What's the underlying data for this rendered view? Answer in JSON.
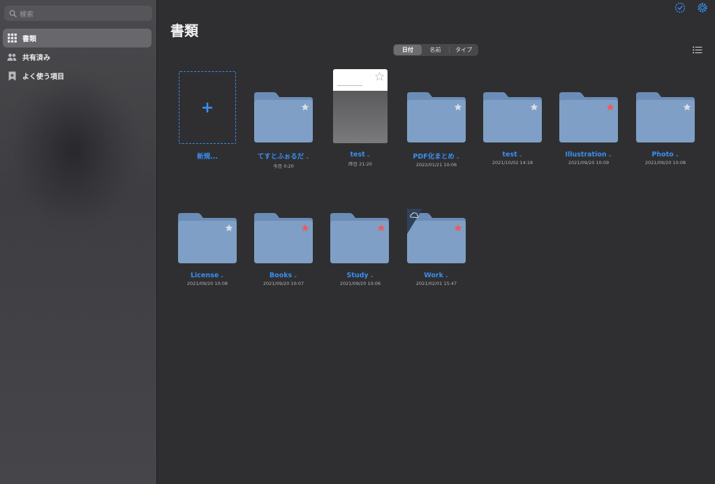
{
  "sidebar": {
    "search_placeholder": "検索",
    "items": [
      {
        "label": "書類",
        "icon": "grid-icon",
        "active": true
      },
      {
        "label": "共有済み",
        "icon": "people-icon",
        "active": false
      },
      {
        "label": "よく使う項目",
        "icon": "bookmark-icon",
        "active": false
      }
    ]
  },
  "header": {
    "title": "書類",
    "sort_options": [
      "日付",
      "名前",
      "タイプ"
    ],
    "selected_sort": "日付"
  },
  "colors": {
    "accent": "#3a8ef0",
    "folder": "#7f9fc6",
    "folder_tab": "#6b8cb6",
    "star_red": "#f05a5a",
    "star_gray": "#d8dde6"
  },
  "items": [
    {
      "type": "new",
      "name": "新規...",
      "date": ""
    },
    {
      "type": "folder",
      "name": "てすとふぉるだ",
      "date": "今日 0:20",
      "star": "gray"
    },
    {
      "type": "doc",
      "name": "test",
      "date": "昨日 21:20",
      "star": "outline"
    },
    {
      "type": "folder",
      "name": "PDF化まとめ",
      "date": "2022/01/21 10:06",
      "star": "gray"
    },
    {
      "type": "folder",
      "name": "test",
      "date": "2021/10/02 14:18",
      "star": "gray"
    },
    {
      "type": "folder",
      "name": "Illustration",
      "date": "2021/09/20 10:09",
      "star": "red"
    },
    {
      "type": "folder",
      "name": "Photo",
      "date": "2021/09/20 10:08",
      "star": "gray"
    },
    {
      "type": "folder",
      "name": "License",
      "date": "2021/09/20 10:08",
      "star": "gray"
    },
    {
      "type": "folder",
      "name": "Books",
      "date": "2021/09/20 10:07",
      "star": "red"
    },
    {
      "type": "folder",
      "name": "Study",
      "date": "2021/09/20 10:06",
      "star": "red"
    },
    {
      "type": "folder",
      "name": "Work",
      "date": "2021/02/01 15:47",
      "star": "red",
      "cloud": true
    }
  ]
}
